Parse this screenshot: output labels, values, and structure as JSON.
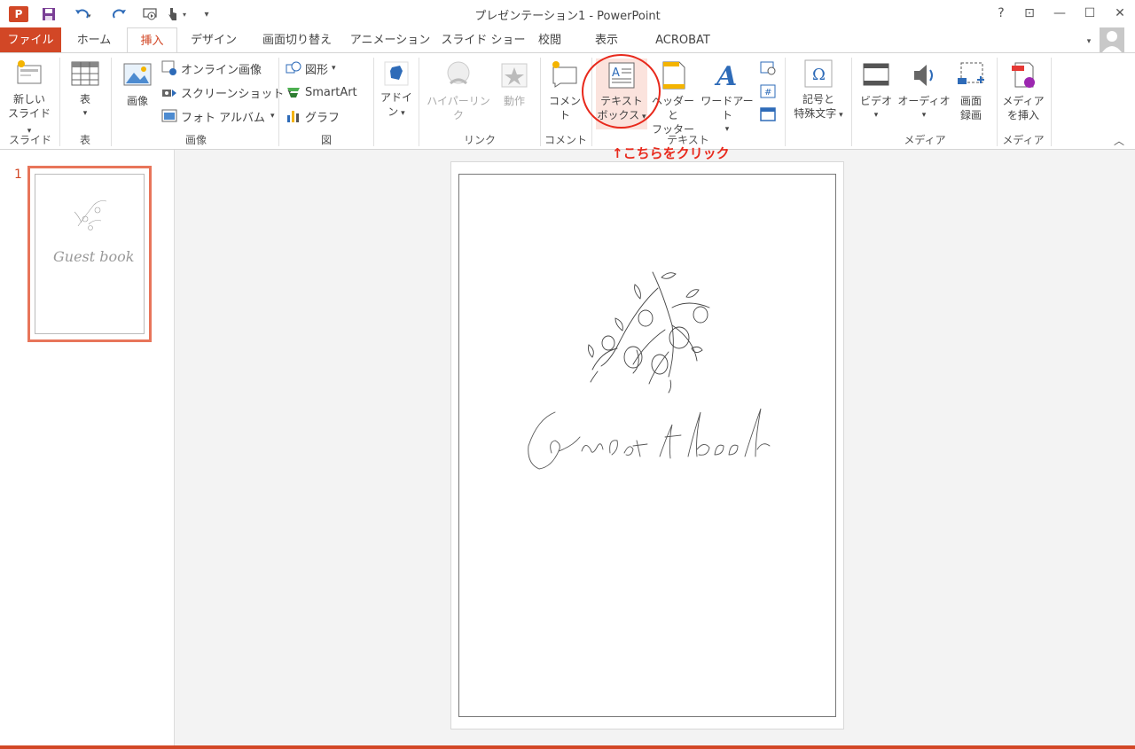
{
  "app": {
    "title": "プレゼンテーション1 - PowerPoint"
  },
  "window_controls": {
    "help": "?",
    "ribbon_display": "⊡",
    "minimize": "—",
    "maximize": "☐",
    "close": "✕"
  },
  "tabs": [
    "ファイル",
    "ホーム",
    "挿入",
    "デザイン",
    "画面切り替え",
    "アニメーション",
    "スライド ショー",
    "校閲",
    "表示",
    "ACROBAT"
  ],
  "active_tab": "挿入",
  "ribbon": {
    "new_slide": {
      "line1": "新しい",
      "line2": "スライド"
    },
    "table": "表",
    "image": "画像",
    "online_image": "オンライン画像",
    "screenshot": "スクリーンショット",
    "photo_album": "フォト アルバム",
    "shapes": "図形",
    "smartart": "SmartArt",
    "graph": "グラフ",
    "addin": {
      "line1": "アドイ",
      "line2": "ン"
    },
    "hyperlink": "ハイパーリンク",
    "action": "動作",
    "comment": "コメント",
    "textbox": {
      "line1": "テキスト",
      "line2": "ボックス"
    },
    "header_footer": {
      "line1": "ヘッダーと",
      "line2": "フッター"
    },
    "wordart": "ワードアート",
    "symbol": {
      "line1": "記号と",
      "line2": "特殊文字"
    },
    "video": "ビデオ",
    "audio": "オーディオ",
    "screen_recording": {
      "line1": "画面",
      "line2": "録画"
    },
    "insert_media": {
      "line1": "メディア",
      "line2": "を挿入"
    },
    "groups": {
      "slide": "スライド",
      "table": "表",
      "image": "画像",
      "figure": "図",
      "link": "リンク",
      "comment": "コメント",
      "text": "テキスト",
      "media": "メディア",
      "media2": "メディア"
    }
  },
  "annotation": "↑こちらをクリック",
  "slide_number": "1",
  "slide_text": "Guest book",
  "colors": {
    "accent": "#d24726",
    "annotation": "#e8291c",
    "thumb_border": "#e8755a"
  }
}
